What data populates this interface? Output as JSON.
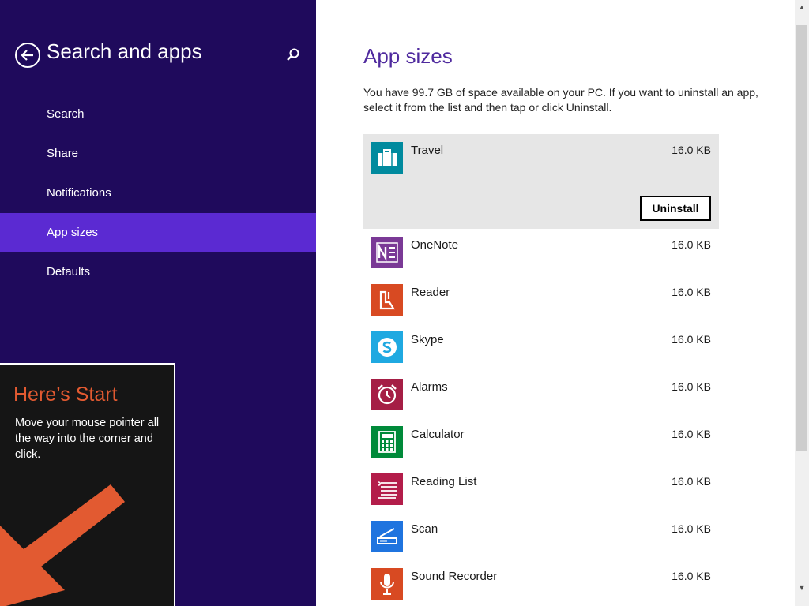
{
  "sidebar": {
    "title": "Search and apps",
    "back_icon": "back-arrow-icon",
    "search_icon": "search-icon",
    "items": [
      {
        "label": "Search",
        "active": false
      },
      {
        "label": "Share",
        "active": false
      },
      {
        "label": "Notifications",
        "active": false
      },
      {
        "label": "App sizes",
        "active": true
      },
      {
        "label": "Defaults",
        "active": false
      }
    ],
    "background_color": "#1f0a5c",
    "active_color": "#5b2ad2"
  },
  "start_tip": {
    "title": "Here’s Start",
    "text": "Move your mouse pointer all the way into the corner and click.",
    "accent_color": "#e25a31",
    "arrow_icon": "down-left-arrow-icon"
  },
  "main": {
    "title": "App sizes",
    "intro": "You have 99.7 GB of space available on your PC. If you want to uninstall an app, select it from the list and then tap or click Uninstall.",
    "uninstall_label": "Uninstall",
    "apps": [
      {
        "name": "Travel",
        "size": "16.0 KB",
        "tile_color": "#008a9e",
        "icon": "suitcase-icon",
        "selected": true
      },
      {
        "name": "OneNote",
        "size": "16.0 KB",
        "tile_color": "#7a3996",
        "icon": "onenote-icon",
        "selected": false
      },
      {
        "name": "Reader",
        "size": "16.0 KB",
        "tile_color": "#d84a22",
        "icon": "reader-icon",
        "selected": false
      },
      {
        "name": "Skype",
        "size": "16.0 KB",
        "tile_color": "#1fa9e1",
        "icon": "skype-icon",
        "selected": false
      },
      {
        "name": "Alarms",
        "size": "16.0 KB",
        "tile_color": "#a51e45",
        "icon": "alarm-clock-icon",
        "selected": false
      },
      {
        "name": "Calculator",
        "size": "16.0 KB",
        "tile_color": "#008a3a",
        "icon": "calculator-icon",
        "selected": false
      },
      {
        "name": "Reading List",
        "size": "16.0 KB",
        "tile_color": "#b31d4a",
        "icon": "reading-list-icon",
        "selected": false
      },
      {
        "name": "Scan",
        "size": "16.0 KB",
        "tile_color": "#1f74df",
        "icon": "scanner-icon",
        "selected": false
      },
      {
        "name": "Sound Recorder",
        "size": "16.0 KB",
        "tile_color": "#d84a22",
        "icon": "microphone-icon",
        "selected": false
      }
    ]
  },
  "scrollbar": {
    "up_icon": "scroll-up-arrow-icon",
    "down_icon": "scroll-down-arrow-icon"
  }
}
